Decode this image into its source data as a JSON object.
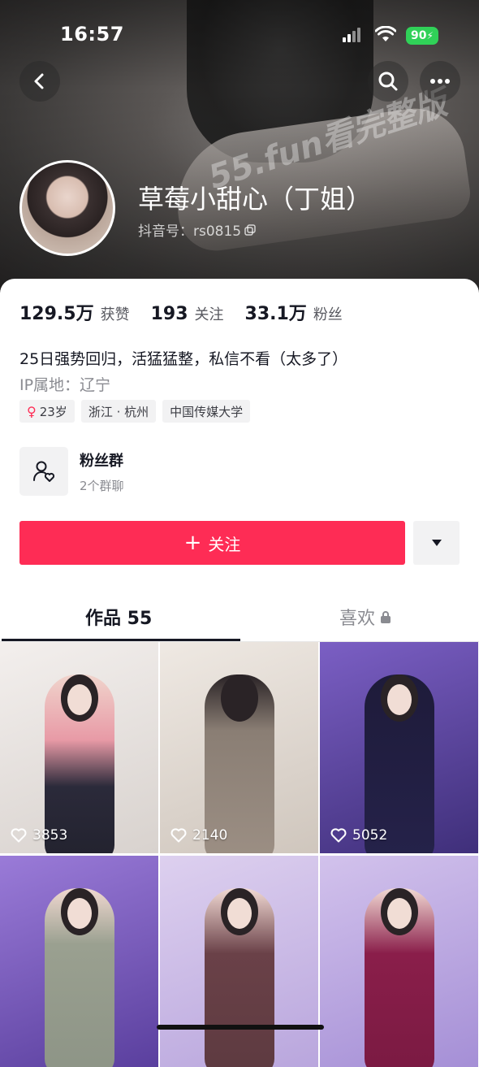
{
  "status": {
    "time": "16:57",
    "battery": "90"
  },
  "header": {
    "watermark": "55.fun看完整版"
  },
  "profile": {
    "name": "草莓小甜心（丁姐）",
    "douyin_id": "抖音号：rs0815",
    "stats": [
      {
        "value": "129.5万",
        "label": "获赞"
      },
      {
        "value": "193",
        "label": "关注"
      },
      {
        "value": "33.1万",
        "label": "粉丝"
      }
    ],
    "bio": "25日强势回归，活猛猛整，私信不看（太多了）",
    "ip": "IP属地：辽宁",
    "tags": {
      "age": "23岁",
      "location": "浙江 · 杭州",
      "school": "中国传媒大学"
    },
    "fan_group": {
      "title": "粉丝群",
      "subtitle": "2个群聊"
    },
    "follow_label": "关注"
  },
  "tabs": {
    "works": "作品 55",
    "likes": "喜欢"
  },
  "videos": [
    {
      "likes": "3853",
      "color": "#e9e2df"
    },
    {
      "likes": "2140",
      "color": "#e6dfd8"
    },
    {
      "likes": "5052",
      "color": "#6a4fb2"
    },
    {
      "likes": "",
      "color": "#8d6bd1"
    },
    {
      "likes": "",
      "color": "#c9b8e6"
    },
    {
      "likes": "",
      "color": "#b4a0dc"
    }
  ],
  "colors": {
    "accent": "#fe2c55"
  }
}
